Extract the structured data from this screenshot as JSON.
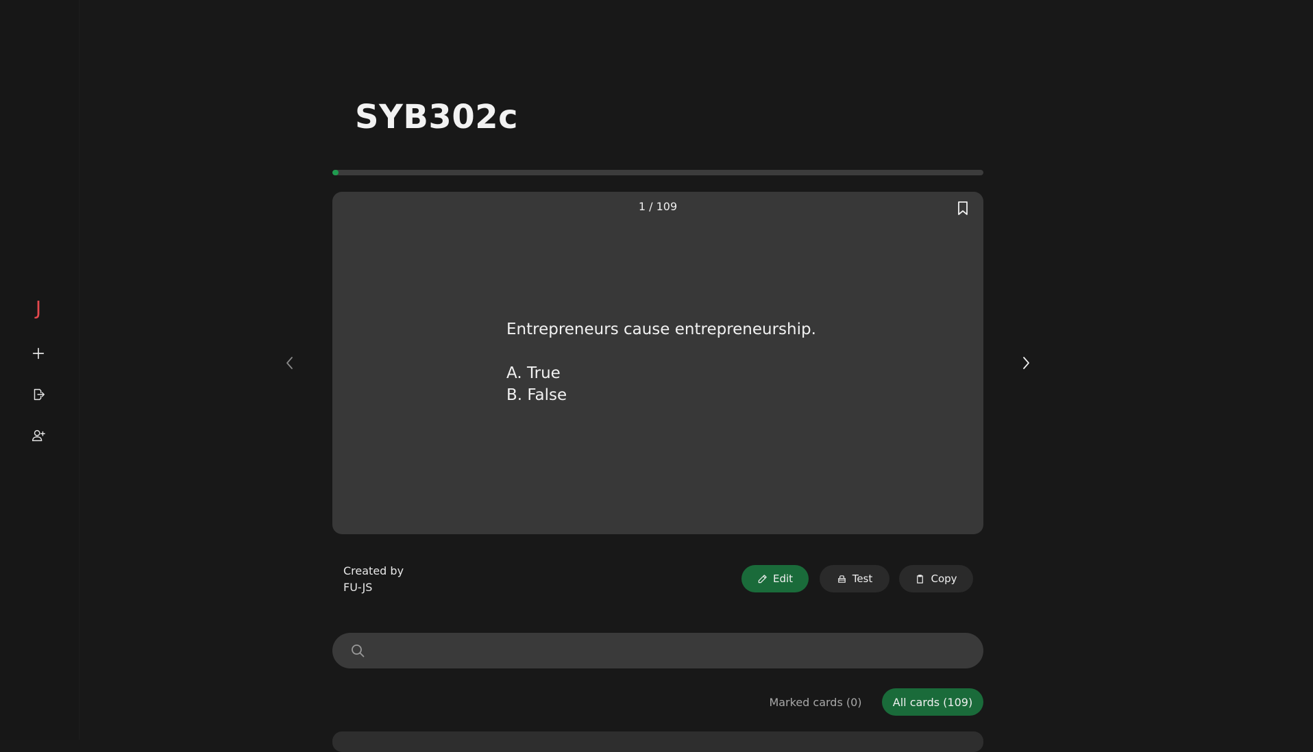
{
  "sidebar": {
    "logo": "J",
    "items": [
      {
        "icon": "plus-icon",
        "name": "create"
      },
      {
        "icon": "logout-icon",
        "name": "logout"
      },
      {
        "icon": "user-plus-icon",
        "name": "add-user"
      }
    ]
  },
  "set": {
    "title": "SYB302c",
    "progress": 0.009,
    "counter": "1 / 109",
    "card": {
      "question": "Entrepreneurs cause entrepreneurship.",
      "option_a": "A. True",
      "option_b": "B. False"
    },
    "created_by_label": "Created by",
    "author": "FU-JS"
  },
  "actions": {
    "edit_label": "Edit",
    "test_label": "Test",
    "copy_label": "Copy"
  },
  "search": {
    "value": "",
    "placeholder": ""
  },
  "filters": {
    "marked_label": "Marked cards (0)",
    "all_label": "All cards (109)"
  },
  "colors": {
    "accent": "#1a6b3a",
    "progress": "#1f9b4f",
    "logo": "#e5484d"
  }
}
